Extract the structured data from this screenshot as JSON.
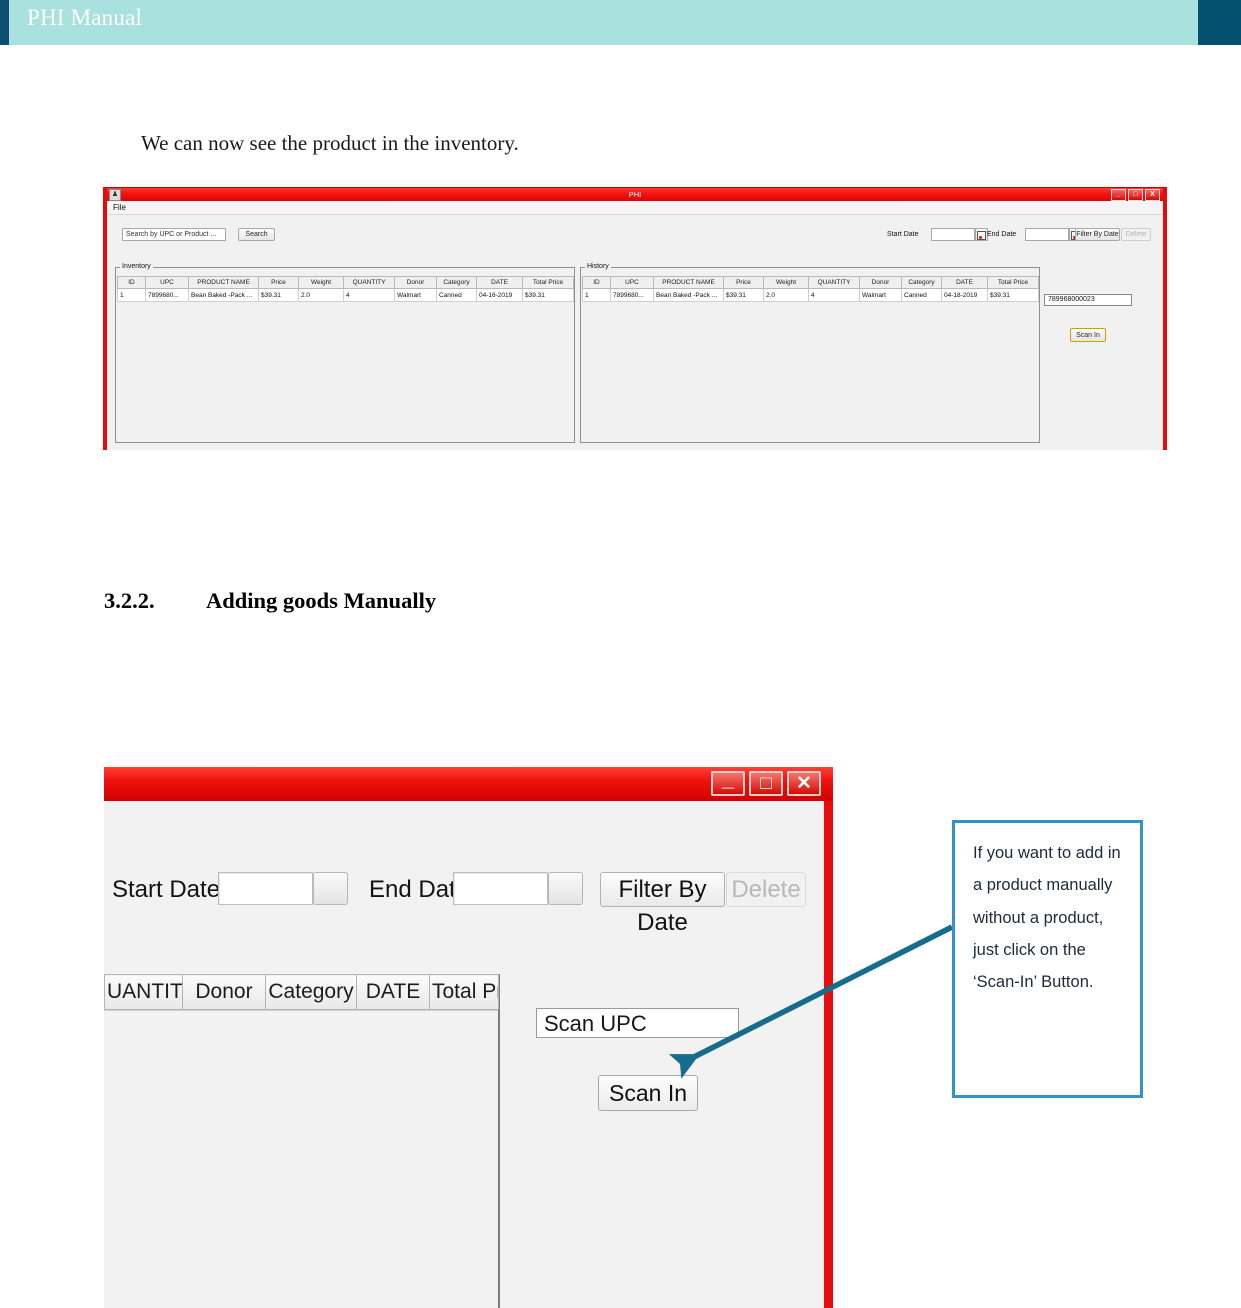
{
  "header": {
    "title": "PHI Manual",
    "band_color": "#a8e1dd",
    "accent_color": "#06506f"
  },
  "document": {
    "intro_paragraph": "We can now see the product in the inventory.",
    "section_number": "3.2.2.",
    "section_title": "Adding goods Manually"
  },
  "screenshot_one": {
    "window_title": "PHI",
    "app_icon": "app-icon",
    "window_buttons": [
      "_",
      "□",
      "X"
    ],
    "menu": [
      "File"
    ],
    "search": {
      "value": "Search by UPC or Product ...",
      "button_label": "Search"
    },
    "date_filter": {
      "start_label": "Start Date",
      "start_value": "",
      "end_label": "End Date",
      "end_value": "",
      "filter_button": "Filter By Date",
      "delete_button": "Delete"
    },
    "inventory": {
      "legend": "Inventory",
      "columns": [
        "ID",
        "UPC",
        "PRODUCT NAME",
        "Price",
        "Weight",
        "QUANTITY",
        "Donor",
        "Category",
        "DATE",
        "Total Price"
      ],
      "rows": [
        [
          "1",
          "7899680...",
          "Bean Baked -Pack ...",
          "$39.31",
          "2.0",
          "4",
          "Walmart",
          "Canned",
          "04-16-2019",
          "$39.31"
        ]
      ]
    },
    "history": {
      "legend": "History",
      "columns": [
        "ID",
        "UPC",
        "PRODUCT NAME",
        "Price",
        "Weight",
        "QUANTITY",
        "Donor",
        "Category",
        "DATE",
        "Total Price"
      ],
      "rows": [
        [
          "1",
          "7899680...",
          "Bean Baked -Pack ...",
          "$39.31",
          "2.0",
          "4",
          "Walmart",
          "Canned",
          "04-18-2019",
          "$39.31"
        ]
      ]
    },
    "scan": {
      "upc_value": "789968000023",
      "button_label": "Scan In"
    }
  },
  "screenshot_two": {
    "window_buttons": [
      "_",
      "□",
      "✕"
    ],
    "date_filter": {
      "start_label": "Start Date",
      "start_value": "",
      "end_label": "End Date",
      "end_value": "",
      "filter_button": "Filter By Date",
      "delete_button": "Delete"
    },
    "table_columns": [
      "UANTITY",
      "Donor",
      "Category",
      "DATE",
      "Total Pri..."
    ],
    "scan": {
      "upc_placeholder": "Scan UPC",
      "upc_value": "Scan UPC",
      "button_label": "Scan In"
    }
  },
  "callout": {
    "text": "If you want to add in a product manually without a product, just click on the ‘Scan-In’ Button.",
    "border_color": "#3293c9",
    "arrow_color": "#156c8c"
  }
}
